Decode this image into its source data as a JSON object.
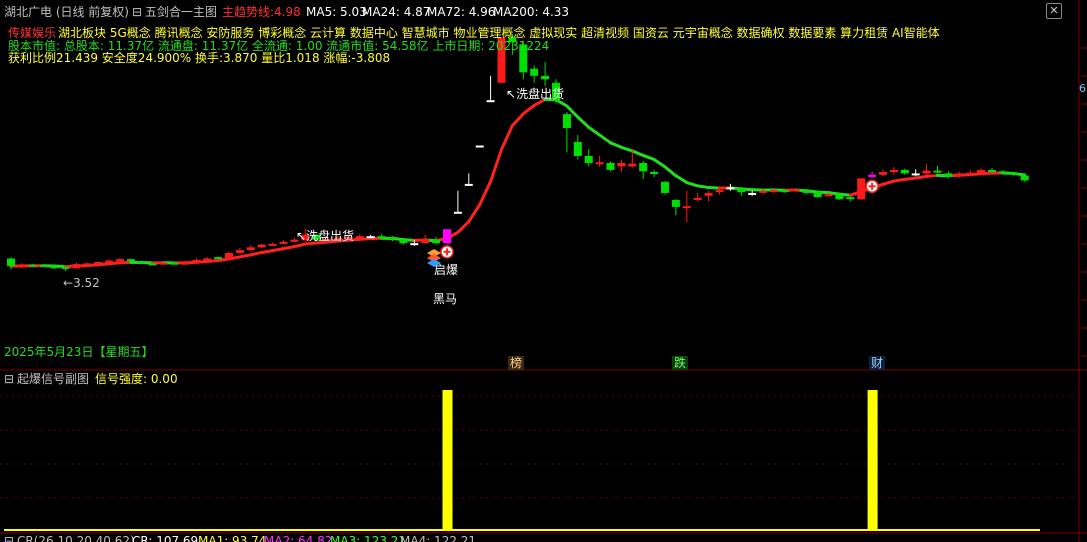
{
  "header": {
    "stock_title": "湖北广电 (日线 前复权)",
    "indicator_icon": "expand-collapse-icon",
    "main_indicator": "五剑合一主图",
    "trend_label": "主趋势线:",
    "trend_value": "4.98",
    "ma5": "MA5: 5.03",
    "ma24": "MA24: 4.87",
    "ma72": "MA72: 4.96",
    "ma200": "MA200: 4.33",
    "colors": {
      "title": "#c0c0c0",
      "trend": "#ff3030",
      "ma": "#ffffff"
    }
  },
  "info": {
    "industry": "传媒娱乐",
    "concepts": "湖北板块 5G概念 腾讯概念 安防服务 博彩概念 云计算 数据中心 智慧城市 物业管理概念 虚拟现实 超清视频 国资云 元宇宙概念 数据确权 数据要素 算力租赁 AI智能体",
    "capital": "股本市值: 总股本: 11.37亿 流通盘: 11.37亿 全流通: 1.00 流通市值: 54.58亿 上市日期: 20231224",
    "stats": "获利比例21.439  安全度24.900%   换手:3.870  量比1.018  涨幅:-3.808"
  },
  "annotations": {
    "low_price": "3.52",
    "wash_out_1": "洗盘出货",
    "wash_out_2": "洗盘出货",
    "explode_label": "启爆",
    "dark_horse_label": "黑马",
    "date_label": "2025年5月23日【星期五】",
    "event_tags": [
      "榜",
      "跌",
      "财"
    ]
  },
  "sub_panel": {
    "title": "起爆信号副图",
    "signal_label": "信号强度: 0.00"
  },
  "bottom_panel": {
    "cr_params": "CR(26,10,20,40,62)",
    "cr": "CR: 107.69",
    "ma1": "MA1: 93.74",
    "ma2": "MA2: 64.82",
    "ma3": "MA3: 123.21",
    "ma4": "MA4: 122.21"
  },
  "window_controls": {
    "close_icon": "close-icon",
    "right_marker": "6"
  },
  "chart_data": {
    "type": "candlestick",
    "title": "",
    "candles": [
      {
        "o": 3.78,
        "c": 3.67,
        "h": 3.8,
        "l": 3.62
      },
      {
        "o": 3.68,
        "c": 3.69,
        "h": 3.71,
        "l": 3.64
      },
      {
        "o": 3.69,
        "c": 3.68,
        "h": 3.7,
        "l": 3.66
      },
      {
        "o": 3.69,
        "c": 3.68,
        "h": 3.7,
        "l": 3.66
      },
      {
        "o": 3.67,
        "c": 3.66,
        "h": 3.68,
        "l": 3.63
      },
      {
        "o": 3.66,
        "c": 3.63,
        "h": 3.66,
        "l": 3.6
      },
      {
        "o": 3.64,
        "c": 3.7,
        "h": 3.72,
        "l": 3.63
      },
      {
        "o": 3.7,
        "c": 3.71,
        "h": 3.72,
        "l": 3.69
      },
      {
        "o": 3.71,
        "c": 3.73,
        "h": 3.74,
        "l": 3.7
      },
      {
        "o": 3.73,
        "c": 3.75,
        "h": 3.77,
        "l": 3.72
      },
      {
        "o": 3.75,
        "c": 3.77,
        "h": 3.79,
        "l": 3.74
      },
      {
        "o": 3.77,
        "c": 3.74,
        "h": 3.78,
        "l": 3.73
      },
      {
        "o": 3.74,
        "c": 3.72,
        "h": 3.75,
        "l": 3.71
      },
      {
        "o": 3.71,
        "c": 3.7,
        "h": 3.72,
        "l": 3.69
      },
      {
        "o": 3.71,
        "c": 3.72,
        "h": 3.73,
        "l": 3.7
      },
      {
        "o": 3.72,
        "c": 3.71,
        "h": 3.74,
        "l": 3.7
      },
      {
        "o": 3.71,
        "c": 3.72,
        "h": 3.75,
        "l": 3.7
      },
      {
        "o": 3.72,
        "c": 3.76,
        "h": 3.79,
        "l": 3.71
      },
      {
        "o": 3.76,
        "c": 3.78,
        "h": 3.8,
        "l": 3.75
      },
      {
        "o": 3.8,
        "c": 3.79,
        "h": 3.81,
        "l": 3.78
      },
      {
        "o": 3.77,
        "c": 3.86,
        "h": 3.88,
        "l": 3.77
      },
      {
        "o": 3.86,
        "c": 3.9,
        "h": 3.93,
        "l": 3.85
      },
      {
        "o": 3.9,
        "c": 3.94,
        "h": 3.97,
        "l": 3.89
      },
      {
        "o": 3.94,
        "c": 3.98,
        "h": 3.99,
        "l": 3.93
      },
      {
        "o": 3.98,
        "c": 3.99,
        "h": 4.01,
        "l": 3.97
      },
      {
        "o": 3.99,
        "c": 4.02,
        "h": 4.04,
        "l": 3.98
      },
      {
        "o": 4.02,
        "c": 4.05,
        "h": 4.08,
        "l": 4.01
      },
      {
        "o": 4.04,
        "c": 4.12,
        "h": 4.21,
        "l": 4.03
      },
      {
        "o": 4.12,
        "c": 4.05,
        "h": 4.13,
        "l": 4.03
      },
      {
        "o": 4.05,
        "c": 4.06,
        "h": 4.09,
        "l": 4.02
      },
      {
        "o": 4.06,
        "c": 4.08,
        "h": 4.1,
        "l": 4.05
      },
      {
        "o": 4.08,
        "c": 4.09,
        "h": 4.12,
        "l": 4.06
      },
      {
        "o": 4.09,
        "c": 4.1,
        "h": 4.13,
        "l": 4.07
      },
      {
        "o": 4.1,
        "c": 4.1,
        "h": 4.12,
        "l": 4.08
      },
      {
        "o": 4.1,
        "c": 4.09,
        "h": 4.13,
        "l": 4.07
      },
      {
        "o": 4.09,
        "c": 4.05,
        "h": 4.1,
        "l": 4.03
      },
      {
        "o": 4.05,
        "c": 4.0,
        "h": 4.06,
        "l": 3.98
      },
      {
        "o": 4.0,
        "c": 4.0,
        "h": 4.05,
        "l": 3.96
      },
      {
        "o": 4.0,
        "c": 4.06,
        "h": 4.12,
        "l": 3.99
      },
      {
        "o": 4.05,
        "c": 4.0,
        "h": 4.09,
        "l": 3.98
      },
      {
        "o": 4.0,
        "c": 4.2,
        "h": 4.2,
        "l": 3.99
      },
      {
        "o": 4.45,
        "c": 4.45,
        "h": 4.75,
        "l": 4.45
      },
      {
        "o": 4.85,
        "c": 4.85,
        "h": 5.0,
        "l": 4.85
      },
      {
        "o": 5.4,
        "c": 5.4,
        "h": 5.4,
        "l": 5.4
      },
      {
        "o": 6.05,
        "c": 6.05,
        "h": 6.4,
        "l": 6.05
      },
      {
        "o": 6.3,
        "c": 6.95,
        "h": 6.95,
        "l": 6.3
      },
      {
        "o": 6.95,
        "c": 6.88,
        "h": 7.0,
        "l": 6.7
      },
      {
        "o": 6.85,
        "c": 6.45,
        "h": 6.9,
        "l": 6.35
      },
      {
        "o": 6.5,
        "c": 6.4,
        "h": 6.55,
        "l": 6.3
      },
      {
        "o": 6.4,
        "c": 6.35,
        "h": 6.6,
        "l": 6.25
      },
      {
        "o": 6.3,
        "c": 6.05,
        "h": 6.35,
        "l": 6.0
      },
      {
        "o": 5.85,
        "c": 5.65,
        "h": 5.88,
        "l": 5.3
      },
      {
        "o": 5.45,
        "c": 5.25,
        "h": 5.55,
        "l": 5.2
      },
      {
        "o": 5.25,
        "c": 5.15,
        "h": 5.35,
        "l": 5.1
      },
      {
        "o": 5.14,
        "c": 5.16,
        "h": 5.25,
        "l": 5.1
      },
      {
        "o": 5.15,
        "c": 5.05,
        "h": 5.17,
        "l": 5.03
      },
      {
        "o": 5.1,
        "c": 5.15,
        "h": 5.2,
        "l": 5.02
      },
      {
        "o": 5.1,
        "c": 5.14,
        "h": 5.35,
        "l": 5.08
      },
      {
        "o": 5.15,
        "c": 5.03,
        "h": 5.18,
        "l": 4.92
      },
      {
        "o": 5.02,
        "c": 5.0,
        "h": 5.05,
        "l": 4.95
      },
      {
        "o": 4.88,
        "c": 4.72,
        "h": 4.89,
        "l": 4.7
      },
      {
        "o": 4.62,
        "c": 4.52,
        "h": 4.63,
        "l": 4.4
      },
      {
        "o": 4.52,
        "c": 4.53,
        "h": 4.75,
        "l": 4.3
      },
      {
        "o": 4.62,
        "c": 4.65,
        "h": 4.72,
        "l": 4.6
      },
      {
        "o": 4.68,
        "c": 4.72,
        "h": 4.75,
        "l": 4.6
      },
      {
        "o": 4.75,
        "c": 4.76,
        "h": 4.8,
        "l": 4.7
      },
      {
        "o": 4.8,
        "c": 4.8,
        "h": 4.85,
        "l": 4.75
      },
      {
        "o": 4.78,
        "c": 4.73,
        "h": 4.8,
        "l": 4.68
      },
      {
        "o": 4.72,
        "c": 4.72,
        "h": 4.75,
        "l": 4.68
      },
      {
        "o": 4.74,
        "c": 4.75,
        "h": 4.78,
        "l": 4.7
      },
      {
        "o": 4.75,
        "c": 4.76,
        "h": 4.8,
        "l": 4.72
      },
      {
        "o": 4.76,
        "c": 4.75,
        "h": 4.78,
        "l": 4.72
      },
      {
        "o": 4.75,
        "c": 4.77,
        "h": 4.79,
        "l": 4.74
      },
      {
        "o": 4.76,
        "c": 4.72,
        "h": 4.77,
        "l": 4.7
      },
      {
        "o": 4.73,
        "c": 4.66,
        "h": 4.74,
        "l": 4.65
      },
      {
        "o": 4.69,
        "c": 4.7,
        "h": 4.72,
        "l": 4.67
      },
      {
        "o": 4.7,
        "c": 4.63,
        "h": 4.72,
        "l": 4.62
      },
      {
        "o": 4.66,
        "c": 4.63,
        "h": 4.68,
        "l": 4.6
      },
      {
        "o": 4.63,
        "c": 4.93,
        "h": 4.93,
        "l": 4.62
      },
      {
        "o": 4.95,
        "c": 4.98,
        "h": 5.03,
        "l": 4.93
      },
      {
        "o": 4.98,
        "c": 5.02,
        "h": 5.06,
        "l": 4.96
      },
      {
        "o": 5.02,
        "c": 5.05,
        "h": 5.09,
        "l": 4.98
      },
      {
        "o": 5.05,
        "c": 5.0,
        "h": 5.07,
        "l": 4.98
      },
      {
        "o": 5.0,
        "c": 5.0,
        "h": 5.06,
        "l": 4.96
      },
      {
        "o": 5.0,
        "c": 5.04,
        "h": 5.13,
        "l": 4.98
      },
      {
        "o": 5.04,
        "c": 5.02,
        "h": 5.11,
        "l": 5.0
      },
      {
        "o": 5.0,
        "c": 4.95,
        "h": 5.03,
        "l": 4.93
      },
      {
        "o": 4.96,
        "c": 5.0,
        "h": 5.02,
        "l": 4.94
      },
      {
        "o": 4.99,
        "c": 5.01,
        "h": 5.05,
        "l": 4.97
      },
      {
        "o": 5.01,
        "c": 5.05,
        "h": 5.07,
        "l": 4.99
      },
      {
        "o": 5.05,
        "c": 5.03,
        "h": 5.08,
        "l": 5.01
      },
      {
        "o": 5.03,
        "c": 5.01,
        "h": 5.05,
        "l": 4.99
      },
      {
        "o": 5.01,
        "c": 4.98,
        "h": 5.02,
        "l": 4.96
      },
      {
        "o": 4.97,
        "c": 4.9,
        "h": 4.98,
        "l": 4.88
      }
    ],
    "signal_bars": [
      40,
      79
    ],
    "signal_strength": 0.0,
    "colors": {
      "up": "#ff1a1a",
      "down": "#00e000",
      "flat": "#ffffff",
      "signal": "#ff00ff",
      "trend_up": "#ff2020",
      "trend_down": "#22dd22",
      "panel_bar": "#ffff00"
    }
  }
}
